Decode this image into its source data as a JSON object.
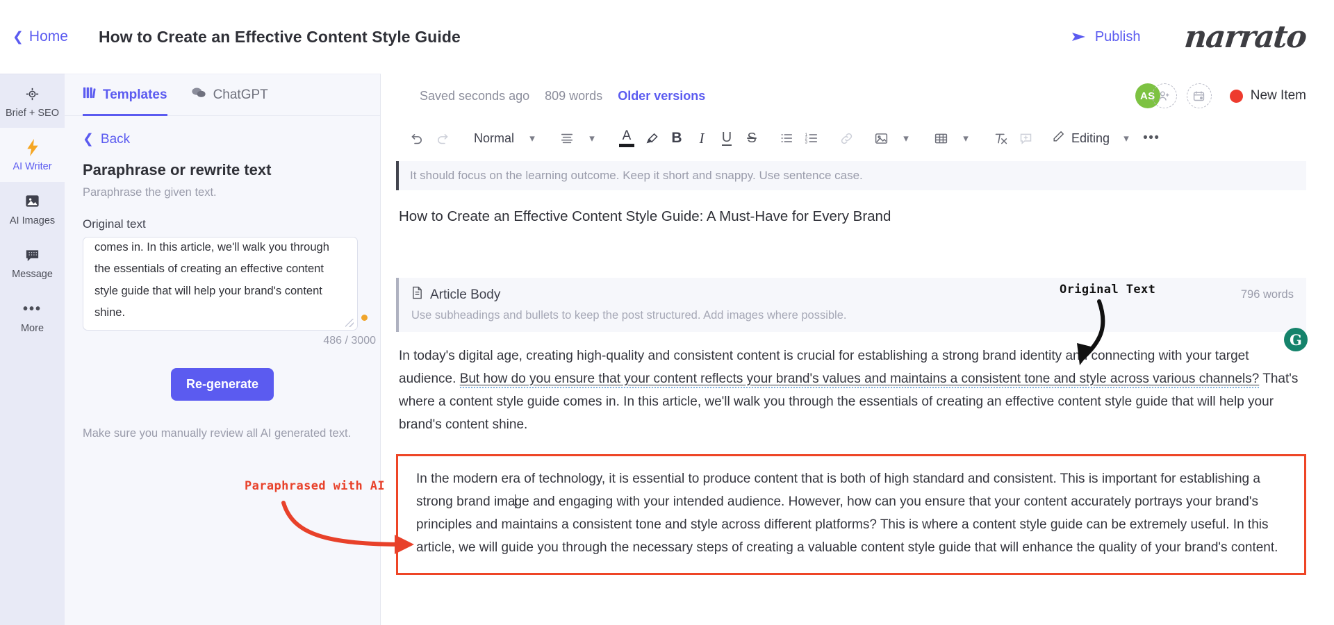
{
  "topbar": {
    "home_label": "Home",
    "doc_title": "How to Create an Effective Content Style Guide",
    "publish_label": "Publish",
    "brand": "narrato"
  },
  "rail": {
    "items": [
      {
        "label": "Brief + SEO",
        "icon": "target-icon",
        "active": false
      },
      {
        "label": "AI Writer",
        "icon": "lightning-icon",
        "active": true
      },
      {
        "label": "AI Images",
        "icon": "image-icon",
        "active": false
      },
      {
        "label": "Message",
        "icon": "chat-icon",
        "active": false
      },
      {
        "label": "More",
        "icon": "ellipsis-icon",
        "active": false
      }
    ]
  },
  "panel": {
    "tabs": [
      {
        "label": "Templates",
        "icon": "templates-icon",
        "active": true
      },
      {
        "label": "ChatGPT",
        "icon": "chat-bubbles-icon",
        "active": false
      }
    ],
    "back_label": "Back",
    "template_title": "Paraphrase or rewrite text",
    "template_subtitle": "Paraphrase the given text.",
    "field_label": "Original text",
    "original_text_visible": "channels? That's where a content style guide comes in. In this article, we'll walk you through the essentials of creating an effective content style guide that will help your brand's content shine.",
    "counter": "486 / 3000",
    "regenerate_label": "Re-generate",
    "disclaimer": "Make sure you manually review all AI generated text.",
    "collapse_icon": "chevron-left-icon"
  },
  "annotations": [
    {
      "text": "Paraphrased with AI",
      "color": "#e8412a"
    },
    {
      "text": "Original Text",
      "color": "#111111"
    }
  ],
  "editor": {
    "status": {
      "saved": "Saved seconds ago",
      "words": "809 words",
      "older_versions": "Older versions"
    },
    "avatar_initials": "AS",
    "new_item_label": "New Item",
    "new_item_dot_color": "#ee3b2e",
    "avatar_color": "#7dc242",
    "toolbar": {
      "undo": "undo-icon",
      "redo": "redo-icon",
      "style_select": "Normal",
      "align": "align-icon",
      "text_color": "text-color-icon",
      "highlight": "highlighter-icon",
      "bold": "B",
      "italic": "I",
      "underline": "U",
      "strikethrough": "S",
      "bullet_list": "bullet-list-icon",
      "numbered_list": "numbered-list-icon",
      "link": "link-icon",
      "image": "image-icon",
      "table": "table-icon",
      "clear_format": "clear-format-icon",
      "comment": "add-comment-icon",
      "mode_label": "Editing",
      "more": "ellipsis-icon"
    },
    "hint_bar": "It should focus on the learning outcome. Keep it short and snappy. Use sentence case.",
    "article_title": "How to Create an Effective Content Style Guide: A Must-Have for Every Brand",
    "section": {
      "icon": "document-icon",
      "name": "Article Body",
      "words": "796 words",
      "hint": "Use subheadings and bullets to keep the post structured. Add images where possible."
    },
    "paragraph_original": {
      "lead": "In today's digital age, creating high-quality and consistent content is crucial for establishing a strong brand identity and connecting with your target audience. ",
      "selected": "But how do you ensure that your content reflects your brand's values and maintains a consistent tone and style across various channels?",
      "tail": " That's where a content style guide comes in. In this article, we'll walk you through the essentials of creating an effective content style guide that will help your brand's content shine."
    },
    "paragraph_paraphrased_a": "In the modern era of technology, it is essential to produce content that is both of high standard and consistent. This is important for establishing a strong brand ima",
    "paragraph_paraphrased_b": "ge and engaging with your intended audience. However, how can you ensure that your content accurately portrays your brand's principles and maintains a consistent tone and style across different platforms? This is where a content style guide can be extremely useful. In this article, we will guide you through the necessary steps of creating a valuable content style guide that will enhance the quality of your brand's content.",
    "grammarly_badge": "G"
  }
}
